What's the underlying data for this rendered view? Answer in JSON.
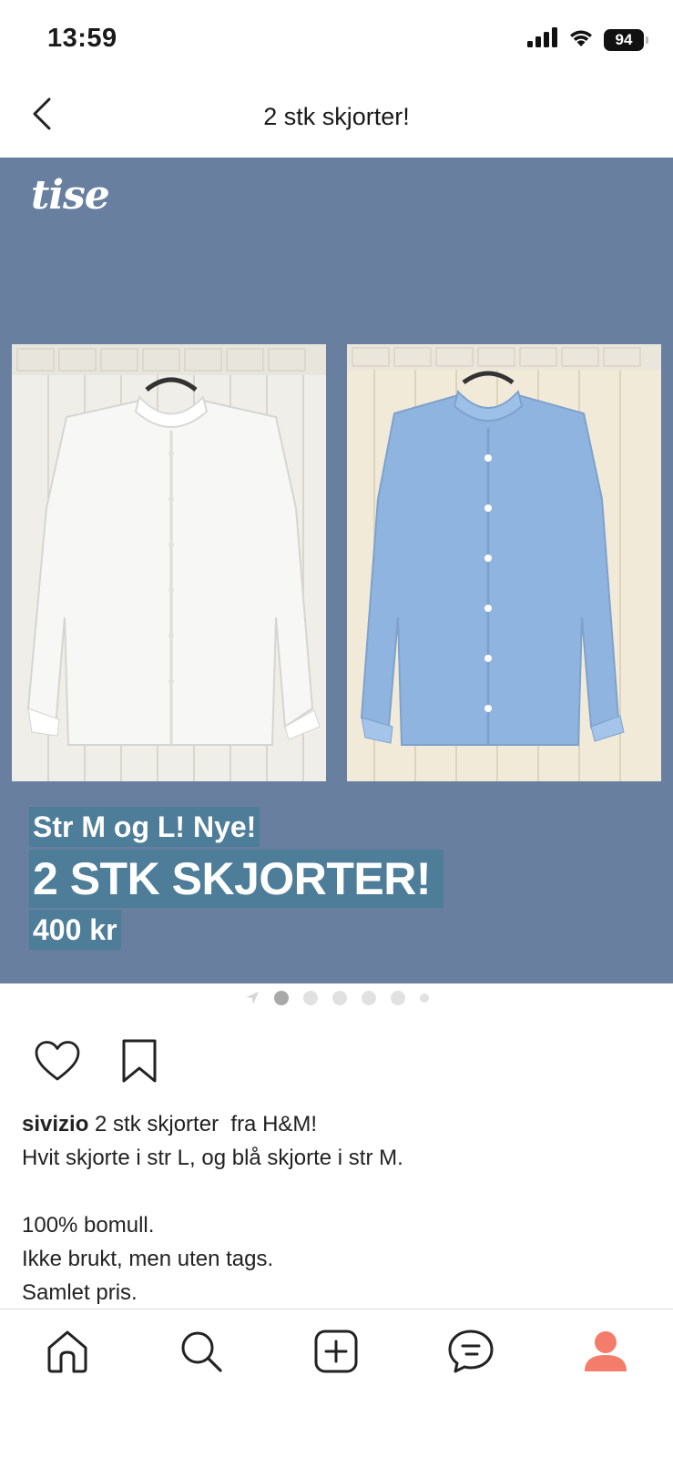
{
  "status_bar": {
    "time": "13:59",
    "battery": "94",
    "icons": [
      "cellular-signal-icon",
      "wifi-icon",
      "battery-icon"
    ]
  },
  "header": {
    "title": "2 stk skjorter!",
    "back_icon": "chevron-left-icon"
  },
  "listing_image": {
    "brand_logo": "tise",
    "background_color": "#687f9f",
    "overlay_color": "#4d7d98",
    "overlay_subtitle": "Str M og L! Nye!",
    "overlay_title": "2 STK SKJORTER!",
    "overlay_price": "400 kr"
  },
  "carousel": {
    "total_dots": 6,
    "active_index": 0
  },
  "actions": {
    "like_icon": "heart-icon",
    "save_icon": "bookmark-icon"
  },
  "description": {
    "username": "sivizio",
    "first_line": " 2 stk skjorter  fra H&M!",
    "lines": [
      "Hvit skjorte i str L, og blå skjorte i str M.",
      "",
      "100% bomull.",
      "Ikke brukt, men uten tags.",
      "Samlet pris."
    ]
  },
  "bottom_nav": {
    "items": [
      "home-icon",
      "search-icon",
      "add-listing-icon",
      "messages-icon",
      "profile-icon"
    ],
    "profile_color": "#f47c6a"
  }
}
